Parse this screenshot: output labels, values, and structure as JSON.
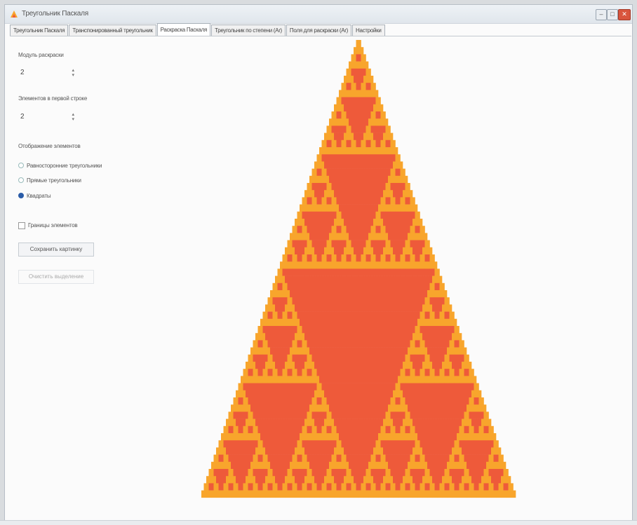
{
  "window": {
    "title": "Треугольник Паскаля",
    "controls": {
      "minimize": "–",
      "maximize": "□",
      "close": "✕"
    }
  },
  "tabs": [
    {
      "label": "Треугольник Паскаля"
    },
    {
      "label": "Транспонированный треугольник"
    },
    {
      "label": "Раскраска Паскаля"
    },
    {
      "label": "Треугольник по степени (Ar)"
    },
    {
      "label": "Поля для раскраски (Ar)"
    },
    {
      "label": "Настройки"
    }
  ],
  "active_tab": 2,
  "panel": {
    "modulus_label": "Модуль раскраски",
    "modulus_value": "2",
    "elements_label": "Элементов в первой строке",
    "elements_value": "2",
    "display_label": "Отображение элементов",
    "radios": [
      {
        "label": "Равносторонние треугольники",
        "selected": false
      },
      {
        "label": "Прямые треугольники",
        "selected": false
      },
      {
        "label": "Квадраты",
        "selected": true
      }
    ],
    "border_checkbox_label": "Границы элементов",
    "border_checkbox_checked": false,
    "save_button": "Сохранить картинку",
    "clear_button": "Очистить выделение"
  },
  "icons": {
    "app": "triangle-app-icon",
    "spin": "up-down-arrows-icon"
  },
  "colors": {
    "accent": "#2b5ca8",
    "fractal_orange": "#f8a52c",
    "fractal_red": "#ee5a3a"
  },
  "fractal": {
    "rows": 64,
    "modulus": 2
  }
}
